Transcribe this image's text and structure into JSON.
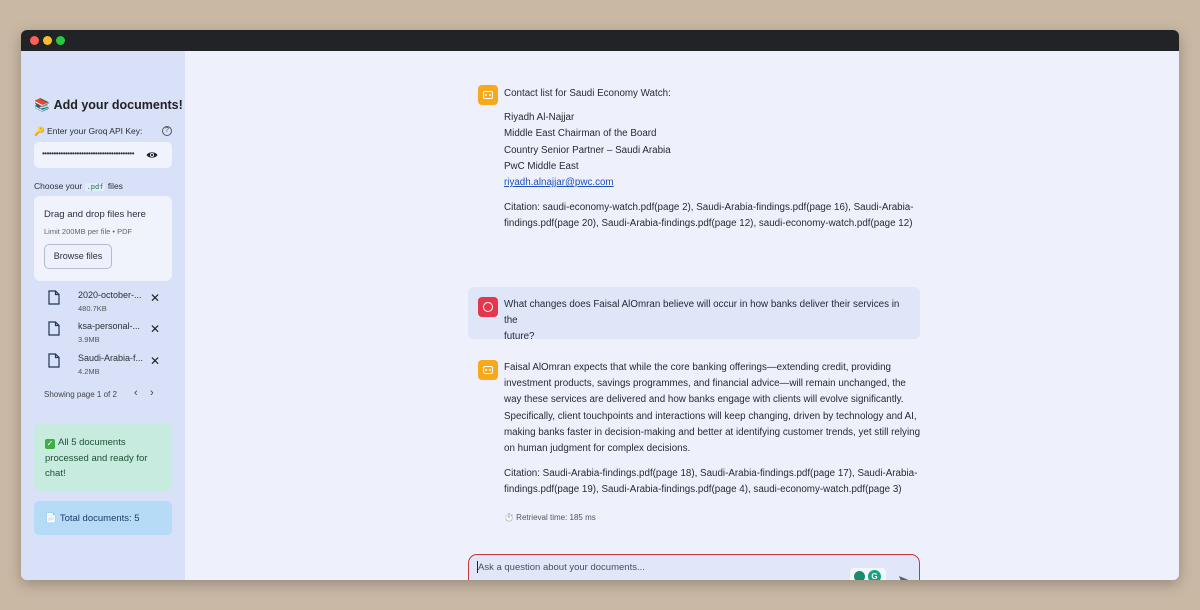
{
  "sidebar": {
    "title": "Add your documents!",
    "api_key_label": "🔑 Enter your Groq API Key:",
    "api_key_value": "••••••••••••••••••••••••••••••••••••••••",
    "choose_prefix": "Choose your",
    "choose_ext": ".pdf",
    "choose_suffix": "files",
    "dropzone_title": "Drag and drop files here",
    "dropzone_limit": "Limit 200MB per file • PDF",
    "browse_label": "Browse files",
    "files": [
      {
        "name": "2020-october-...",
        "size": "480.7KB"
      },
      {
        "name": "ksa-personal-...",
        "size": "3.9MB"
      },
      {
        "name": "Saudi-Arabia-f...",
        "size": "4.2MB"
      }
    ],
    "pager_text": "Showing page 1 of 2",
    "success_text": "All 5 documents processed and ready for chat!",
    "info_text": "Total documents: 5"
  },
  "chat": {
    "messages": [
      {
        "role": "assistant",
        "lines": [
          "Contact list for Saudi Economy Watch:",
          "Riyadh Al-Najjar",
          "Middle East Chairman of the Board",
          "Country Senior Partner – Saudi Arabia",
          "PwC Middle East",
          "riyadh.alnajjar@pwc.com"
        ],
        "citation_1": "Citation: saudi-economy-watch.pdf(page 2), Saudi-Arabia-findings.pdf(page 16), Saudi-Arabia-",
        "citation_2": "findings.pdf(page 20), Saudi-Arabia-findings.pdf(page 12), saudi-economy-watch.pdf(page 12)"
      },
      {
        "role": "user",
        "line_1": "What changes does Faisal AlOmran believe will occur in how banks deliver their services in the",
        "line_2": "future?"
      },
      {
        "role": "assistant",
        "lines": [
          "Faisal AlOmran expects that while the core banking offerings—extending credit, providing",
          "investment products, savings programmes, and financial advice—will remain unchanged, the",
          "way these services are delivered and how banks engage with clients will evolve significantly.",
          "Specifically, client touchpoints and interactions will keep changing, driven by technology and AI,",
          "making banks faster in decision-making and better at identifying customer trends, yet still relying",
          "on human judgment for complex decisions."
        ],
        "citation_1": "Citation: Saudi-Arabia-findings.pdf(page 18), Saudi-Arabia-findings.pdf(page 17), Saudi-Arabia-",
        "citation_2": "findings.pdf(page 19), Saudi-Arabia-findings.pdf(page 4), saudi-economy-watch.pdf(page 3)",
        "retrieval": "⏱️ Retrieval time: 185 ms"
      }
    ],
    "input_placeholder": "Ask a question about your documents..."
  },
  "colors": {
    "bot_avatar": "#f7a81b",
    "user_avatar": "#e5374b",
    "input_border": "#c9343e",
    "success_bg": "#c7ebde",
    "info_bg": "#b5dbf7"
  },
  "icons": [
    "book-icon",
    "key-icon",
    "help-icon",
    "eye-icon",
    "file-icon",
    "close-icon",
    "chevron-left-icon",
    "chevron-right-icon",
    "check-icon",
    "document-icon",
    "bot-avatar-icon",
    "user-avatar-icon",
    "stopwatch-icon",
    "grammarly-icon",
    "send-icon"
  ]
}
